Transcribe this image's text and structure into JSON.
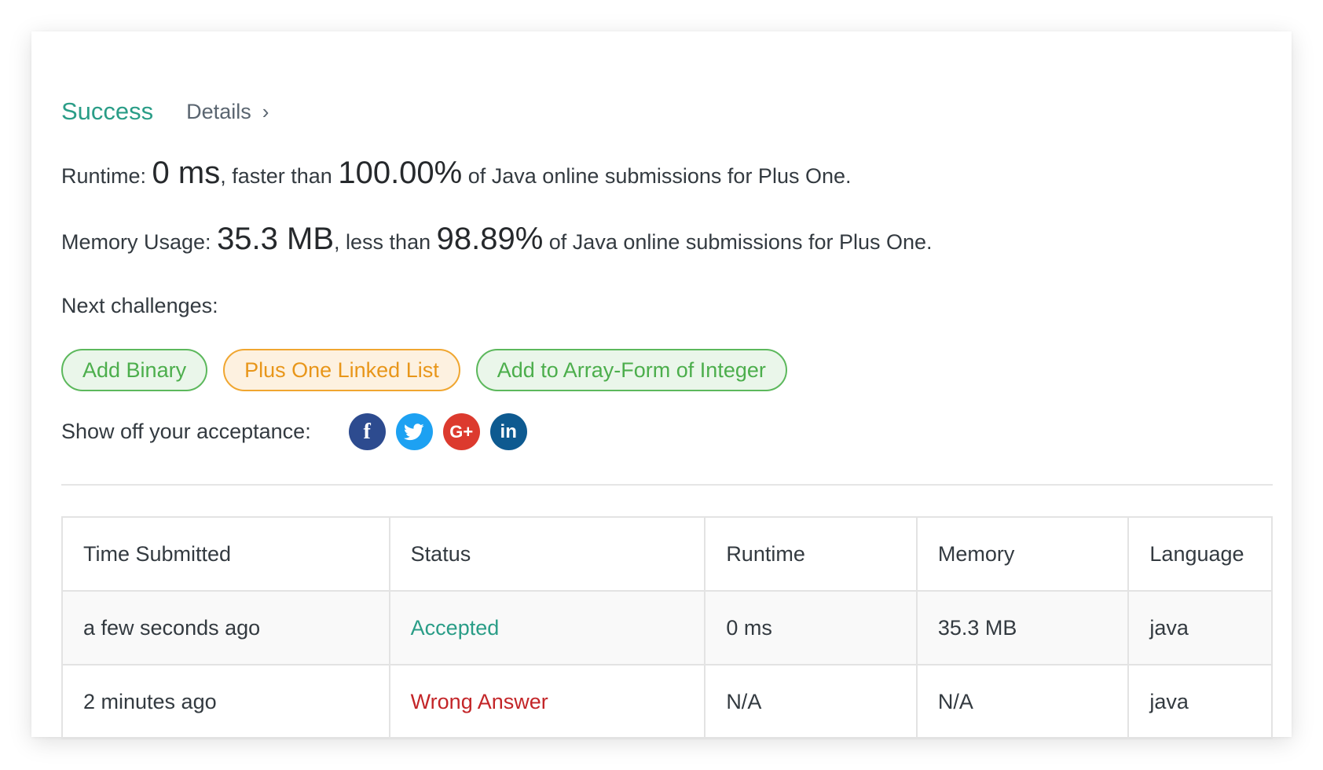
{
  "result": {
    "status": "Success",
    "details_label": "Details",
    "chevron": "›"
  },
  "runtime": {
    "label": "Runtime: ",
    "value": "0 ms",
    "sep": ", faster than ",
    "percent": "100.00%",
    "tail": " of Java online submissions for Plus One."
  },
  "memory": {
    "label": "Memory Usage: ",
    "value": "35.3 MB",
    "sep": ", less than ",
    "percent": "98.89%",
    "tail": " of Java online submissions for Plus One."
  },
  "next": {
    "label": "Next challenges:",
    "items": [
      {
        "label": "Add Binary",
        "color": "green"
      },
      {
        "label": "Plus One Linked List",
        "color": "orange"
      },
      {
        "label": "Add to Array-Form of Integer",
        "color": "green"
      }
    ]
  },
  "share": {
    "label": "Show off your acceptance:",
    "icons": [
      {
        "name": "facebook-icon",
        "glyph": "f",
        "color": "#2d4b8f"
      },
      {
        "name": "twitter-icon",
        "glyph": "",
        "color": "#1da1f2"
      },
      {
        "name": "google-plus-icon",
        "glyph": "G+",
        "color": "#dc3a2e"
      },
      {
        "name": "linkedin-icon",
        "glyph": "in",
        "color": "#0e5a90"
      }
    ]
  },
  "table": {
    "headers": [
      "Time Submitted",
      "Status",
      "Runtime",
      "Memory",
      "Language"
    ],
    "rows": [
      {
        "time": "a few seconds ago",
        "status": "Accepted",
        "runtime": "0 ms",
        "memory": "35.3 MB",
        "language": "java"
      },
      {
        "time": "2 minutes ago",
        "status": "Wrong Answer",
        "runtime": "N/A",
        "memory": "N/A",
        "language": "java"
      }
    ]
  },
  "colors": {
    "success": "#2a9d87",
    "wrong": "#c32528",
    "chip_green": "#4cae4c",
    "chip_orange": "#e8961a"
  }
}
